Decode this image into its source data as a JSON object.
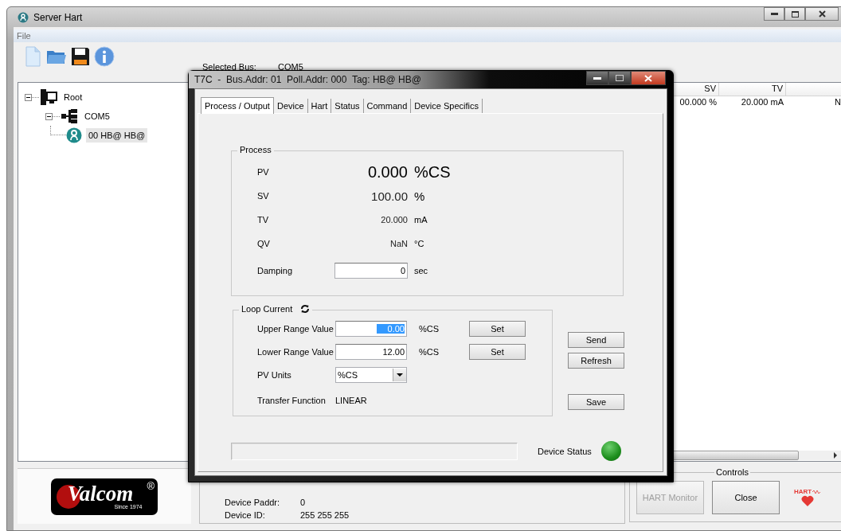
{
  "window": {
    "title": "Server Hart"
  },
  "menu": [
    {
      "label": "File"
    }
  ],
  "toolbar": [
    {
      "kind": "new"
    },
    {
      "kind": "open"
    },
    {
      "kind": "save"
    },
    {
      "kind": "info"
    }
  ],
  "selected_bus": {
    "label": "Selected Bus:",
    "value": "COM5"
  },
  "tree": [
    {
      "label": "Root",
      "kind": "computer",
      "expanded": true,
      "selected": false,
      "children": [
        {
          "label": "COM5",
          "kind": "bus",
          "expanded": true,
          "selected": false,
          "children": [
            {
              "label": "00 HB@ HB@",
              "kind": "device",
              "selected": true
            }
          ]
        }
      ]
    }
  ],
  "device_list": {
    "columns": [
      "SV",
      "TV"
    ],
    "rows": [
      {
        "sv": "00.000 %",
        "tv": "20.000 mA",
        "column_3": "N"
      }
    ]
  },
  "logo": {
    "name": "Valcom",
    "mark": "®",
    "since": "Since 1974"
  },
  "device_info": [
    {
      "label": "Device Paddr:",
      "value": "0"
    },
    {
      "label": "Device ID:",
      "value": "255 255 255"
    }
  ],
  "controls": {
    "title": "Controls",
    "buttons": [
      {
        "label": "HART Monitor",
        "disabled": true
      },
      {
        "label": "Close",
        "disabled": false
      }
    ],
    "logo_text": "HART"
  },
  "dialog": {
    "title": "T7C  -  Bus.Addr: 01  Poll.Addr: 000  Tag: HB@ HB@",
    "tabs": [
      {
        "label": "Process / Output",
        "selected": true
      },
      {
        "label": "Device",
        "selected": false
      },
      {
        "label": "Hart",
        "selected": false
      },
      {
        "label": "Status",
        "selected": false
      },
      {
        "label": "Command",
        "selected": false
      },
      {
        "label": "Device Specifics",
        "selected": false
      }
    ],
    "process": {
      "title": "Process",
      "rows": [
        {
          "label": "PV",
          "value": "0.000",
          "unit": "%CS",
          "kind": "large"
        },
        {
          "label": "SV",
          "value": "100.00",
          "unit": "%",
          "kind": "medium"
        },
        {
          "label": "TV",
          "value": "20.000",
          "unit": "mA",
          "kind": "small"
        },
        {
          "label": "QV",
          "value": "NaN",
          "unit": "°C",
          "kind": "small"
        }
      ],
      "damping": {
        "label": "Damping",
        "value": "0",
        "unit": "sec"
      }
    },
    "loop_current": {
      "title": "Loop Current",
      "ranges": [
        {
          "label": "Upper Range Value",
          "value": "0.00",
          "unit": "%CS",
          "highlighted": true,
          "button": "Set"
        },
        {
          "label": "Lower Range Value",
          "value": "12.00",
          "unit": "%CS",
          "highlighted": false,
          "button": "Set"
        }
      ],
      "pv_units": {
        "label": "PV Units",
        "value": "%CS"
      },
      "transfer_function": {
        "label": "Transfer Function",
        "value": "LINEAR"
      }
    },
    "actions": [
      {
        "label": "Send"
      },
      {
        "label": "Refresh"
      },
      {
        "label": "Save"
      }
    ],
    "device_status": {
      "label": "Device Status",
      "on": true
    }
  }
}
